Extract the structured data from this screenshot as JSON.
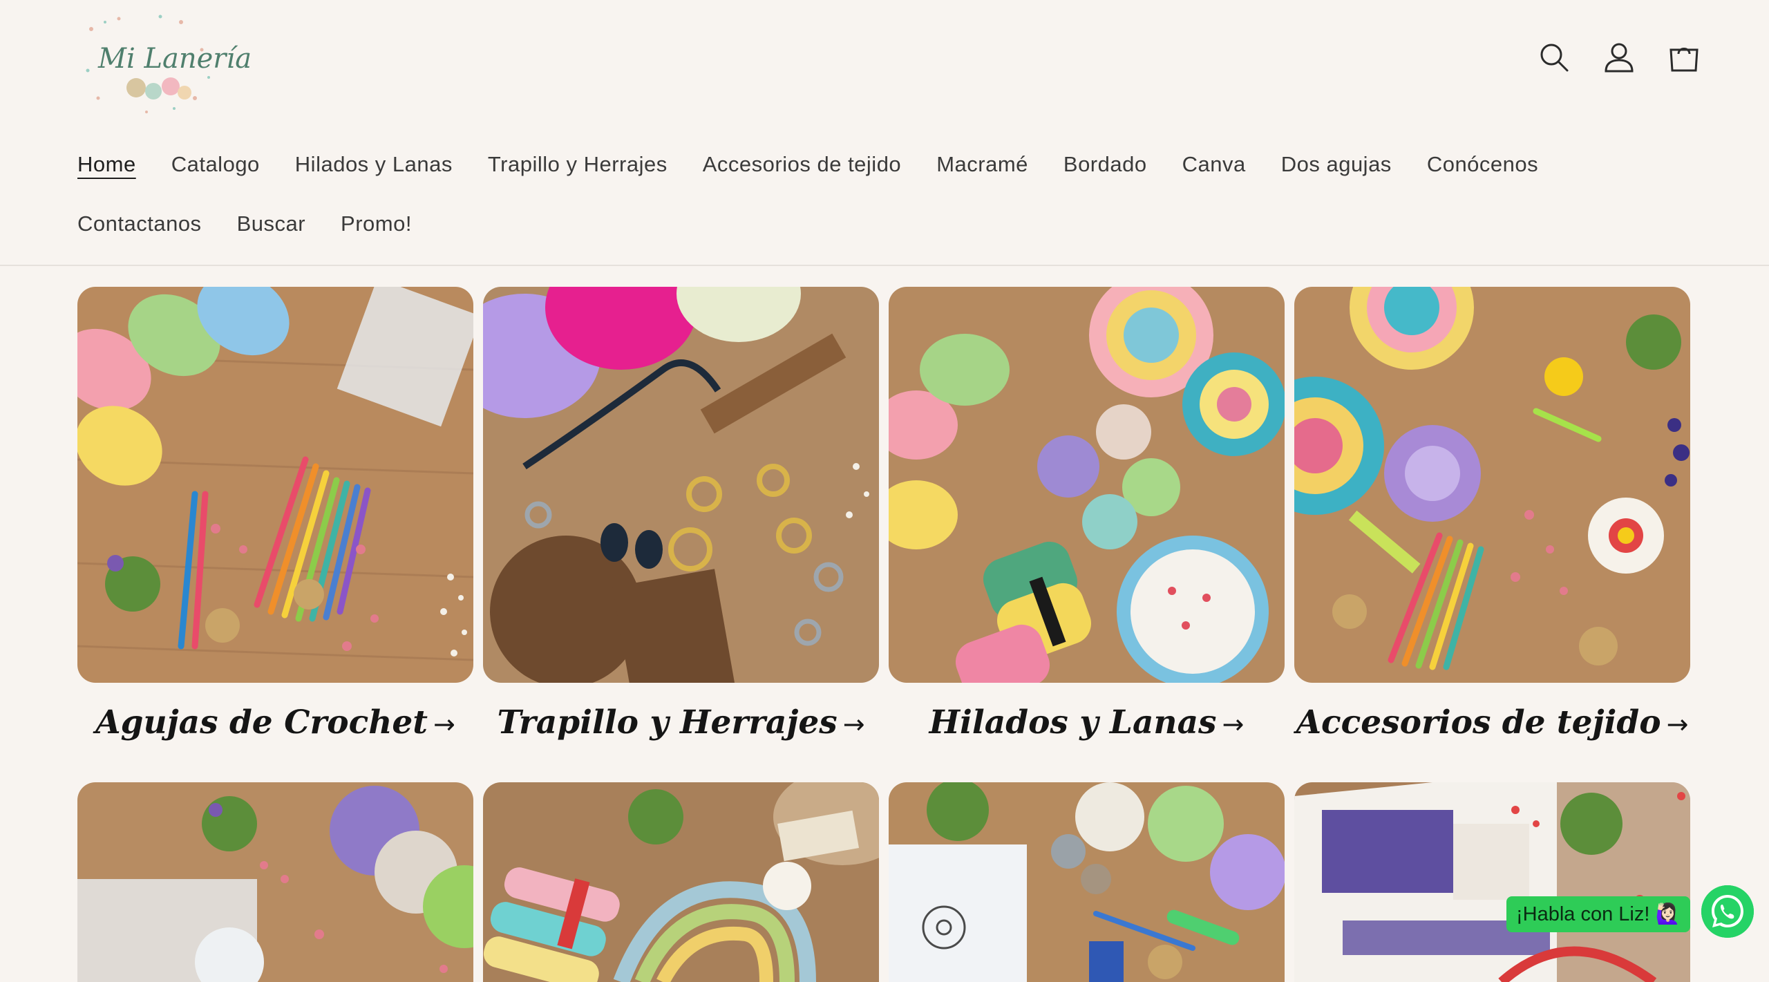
{
  "brand": {
    "logo_text": "Mi Lanería"
  },
  "header": {
    "icons": [
      "search-icon",
      "account-icon",
      "cart-icon"
    ]
  },
  "nav": {
    "row1": [
      "Home",
      "Catalogo",
      "Hilados y Lanas",
      "Trapillo y Herrajes",
      "Accesorios de tejido",
      "Macramé",
      "Bordado",
      "Canva",
      "Dos agujas",
      "Conócenos"
    ],
    "row2": [
      "Contactanos",
      "Buscar",
      "Promo!"
    ],
    "active": "Home"
  },
  "collections": [
    {
      "title": "Agujas de Crochet",
      "arrow": "→"
    },
    {
      "title": "Trapillo y Herrajes",
      "arrow": "→"
    },
    {
      "title": "Hilados y Lanas",
      "arrow": "→"
    },
    {
      "title": "Accesorios de tejido",
      "arrow": "→"
    }
  ],
  "whatsapp": {
    "label": "¡Habla con Liz! 🙋🏻‍♀️",
    "color": "#25d366"
  },
  "colors": {
    "background": "#f8f4f0",
    "text": "#2b2b2b",
    "accent": "#4f7f6d"
  }
}
